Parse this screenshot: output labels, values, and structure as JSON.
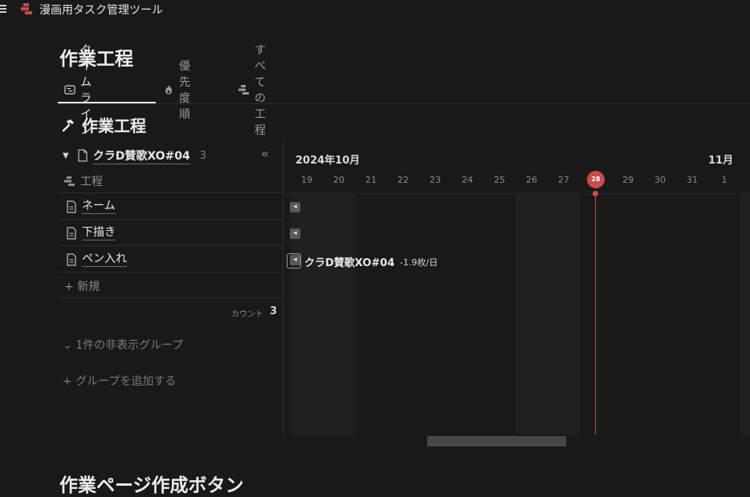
{
  "topbar": {
    "app_title": "漫画用タスク管理ツール"
  },
  "page": {
    "title": "作業工程"
  },
  "tabs": [
    {
      "label": "タイムライン"
    },
    {
      "label": "優先度順"
    },
    {
      "label": "すべての工程"
    }
  ],
  "database": {
    "title": "作業工程"
  },
  "group": {
    "name": "クラD賛歌XO#04",
    "count": "3",
    "column_header": "工程",
    "rows": [
      {
        "label": "ネーム"
      },
      {
        "label": "下描き"
      },
      {
        "label": "ペン入れ"
      }
    ],
    "new_label": "新規",
    "count_label": "カウント",
    "count_value": "3"
  },
  "hidden_groups": "1件の非表示グループ",
  "add_group": "グループを追加する",
  "timeline": {
    "month_label": "2024年10月",
    "next_month_label": "11月",
    "days": [
      "19",
      "20",
      "21",
      "22",
      "23",
      "24",
      "25",
      "26",
      "27",
      "28",
      "29",
      "30",
      "31",
      "1"
    ],
    "today": "28",
    "bar": {
      "title": "クラD賛歌XO#04",
      "rate": "-1.9枚/日"
    }
  },
  "next_section": {
    "title": "作業ページ作成ボタン"
  },
  "colors": {
    "background": "#191919",
    "today_marker": "#c94a4a"
  }
}
